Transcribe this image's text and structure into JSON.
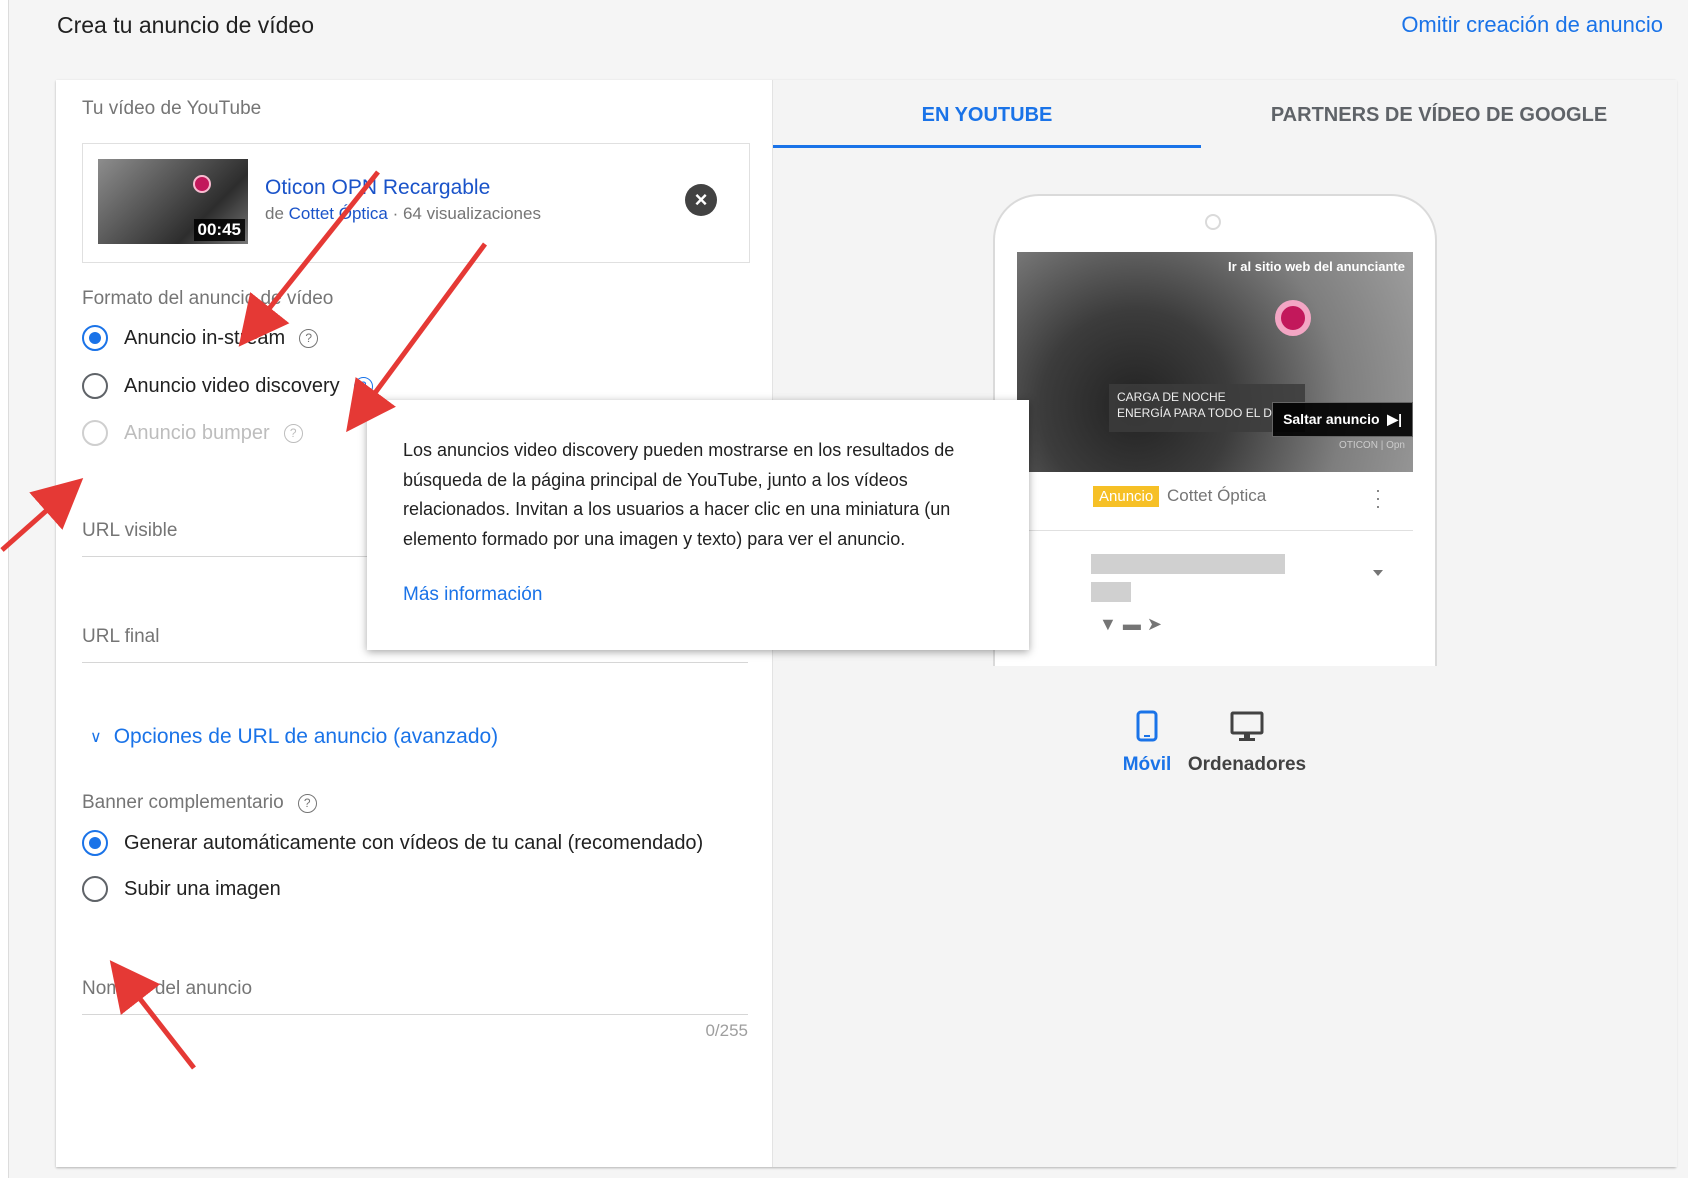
{
  "header": {
    "title": "Crea tu anuncio de vídeo",
    "skip_link": "Omitir creación de anuncio"
  },
  "video": {
    "section_label": "Tu vídeo de YouTube",
    "title": "Oticon OPN Recargable",
    "by": "de",
    "channel": "Cottet Óptica",
    "views": " · 64 visualizaciones",
    "duration": "00:45",
    "remove_icon": "close-circle-icon"
  },
  "format": {
    "label": "Formato del anuncio de vídeo",
    "options": [
      {
        "label": "Anuncio in-stream",
        "selected": true,
        "disabled": false
      },
      {
        "label": "Anuncio video discovery",
        "selected": false,
        "disabled": false
      },
      {
        "label": "Anuncio bumper",
        "selected": false,
        "disabled": true
      }
    ]
  },
  "fields": {
    "visible_url": "URL visible",
    "final_url": "URL final",
    "advanced": "Opciones de URL de anuncio (avanzado)",
    "ad_name": "Nombre del anuncio",
    "ad_name_counter": "0/255"
  },
  "banner": {
    "label": "Banner complementario",
    "options": [
      {
        "label": "Generar automáticamente con vídeos de tu canal (recomendado)",
        "selected": true
      },
      {
        "label": "Subir una imagen",
        "selected": false
      }
    ]
  },
  "tooltip": {
    "text": "Los anuncios video discovery pueden mostrarse en los resultados de búsqueda de la página principal de YouTube, junto a los vídeos relacionados. Invitan a los usuarios a hacer clic en una miniatura (un elemento formado por una imagen y texto) para ver el anuncio.",
    "link": "Más información"
  },
  "preview": {
    "tabs": [
      {
        "label": "EN YOUTUBE",
        "active": true
      },
      {
        "label": "PARTNERS DE VÍDEO DE GOOGLE",
        "active": false
      }
    ],
    "visit_site": "Ir al sitio web del anunciante",
    "caption_line1": "CARGA DE NOCHE",
    "caption_line2": "ENERGÍA PARA TODO EL D",
    "skip_ad": "Saltar anuncio",
    "brand": "OTICON | Opn",
    "ad_badge": "Anuncio",
    "advertiser": "Cottet Óptica",
    "devices": [
      {
        "label": "Móvil",
        "icon": "smartphone-icon",
        "active": true
      },
      {
        "label": "Ordenadores",
        "icon": "desktop-icon",
        "active": false
      }
    ]
  },
  "colors": {
    "accent": "#1a73e8",
    "annotation_arrow": "#e53935",
    "ad_badge": "#f6c026"
  }
}
